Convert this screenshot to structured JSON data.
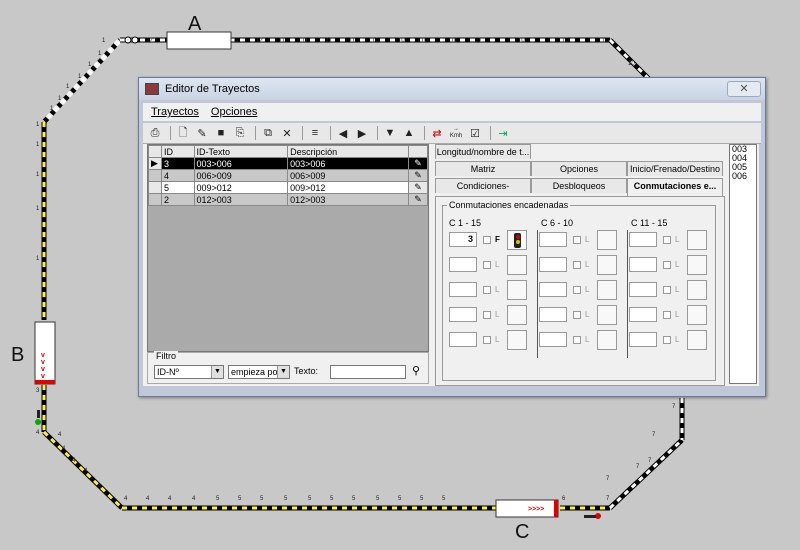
{
  "track_labels": {
    "a": "A",
    "b": "B",
    "c": "C"
  },
  "track_numbers": {
    "top": [
      "1",
      "12",
      "12",
      "12",
      "11",
      "11",
      "11",
      "11",
      "10",
      "10",
      "10",
      "10",
      "10",
      "10",
      "10"
    ],
    "top_right": [
      "10",
      "10"
    ],
    "left": [
      "1",
      "1",
      "1",
      "1",
      "1",
      "1",
      "1",
      "1",
      "1",
      "1",
      "1"
    ],
    "left_bottom": [
      "3",
      "4"
    ],
    "lower_left": [
      "4",
      "4",
      "4",
      "4",
      "4"
    ],
    "bottom": [
      "4",
      "4",
      "4",
      "4",
      "5",
      "5",
      "5",
      "5",
      "5",
      "5",
      "5",
      "5",
      "5",
      "5",
      "5",
      "6"
    ],
    "right_lower": [
      "7",
      "7",
      "7",
      "7",
      "7",
      "7"
    ]
  },
  "window": {
    "title": "Editor de Trayectos",
    "close_glyph": "✕"
  },
  "menu": {
    "trayectos": "Trayectos",
    "opciones": "Opciones"
  },
  "toolbar": {
    "icons": [
      "print-icon",
      "new-document-icon",
      "edit-document-icon",
      "save-icon",
      "print-preview-icon",
      "copy-icon",
      "delete-icon",
      "list-icon",
      "arrow-left-icon",
      "arrow-right-icon",
      "arrow-down-icon",
      "arrow-up-icon",
      "swap-icon",
      "speed-kmh-icon",
      "checklist-icon",
      "exit-icon"
    ],
    "kmh_label": "Kmh"
  },
  "grid": {
    "columns": [
      "ID",
      "ID-Texto",
      "Descripción"
    ],
    "rows": [
      {
        "id": "3",
        "texto": "003>006",
        "desc": "003>006"
      },
      {
        "id": "4",
        "texto": "006>009",
        "desc": "006>009"
      },
      {
        "id": "5",
        "texto": "009>012",
        "desc": "009>012"
      },
      {
        "id": "2",
        "texto": "012>003",
        "desc": "012>003"
      }
    ]
  },
  "filtro": {
    "legend": "Filtro",
    "field": "ID-Nº",
    "mode": "empieza por",
    "texto_label": "Texto:",
    "texto_value": ""
  },
  "tabs": {
    "row1": [
      "Longitud/nombre de t..."
    ],
    "row2": [
      "Matriz",
      "Opciones",
      "Inicio/Frenado/Destino"
    ],
    "row3": [
      "Condiciones-conmuta...",
      "Desbloqueos",
      "Conmutaciones e..."
    ]
  },
  "conmutaciones": {
    "legend": "Conmutaciones encadenadas",
    "columns": [
      "C 1 - 15",
      "C 6 - 10",
      "C 11 - 15"
    ],
    "first_value": "3",
    "first_flag": "F",
    "flag_label": "L"
  },
  "id_list": [
    "003",
    "004",
    "005",
    "006"
  ]
}
